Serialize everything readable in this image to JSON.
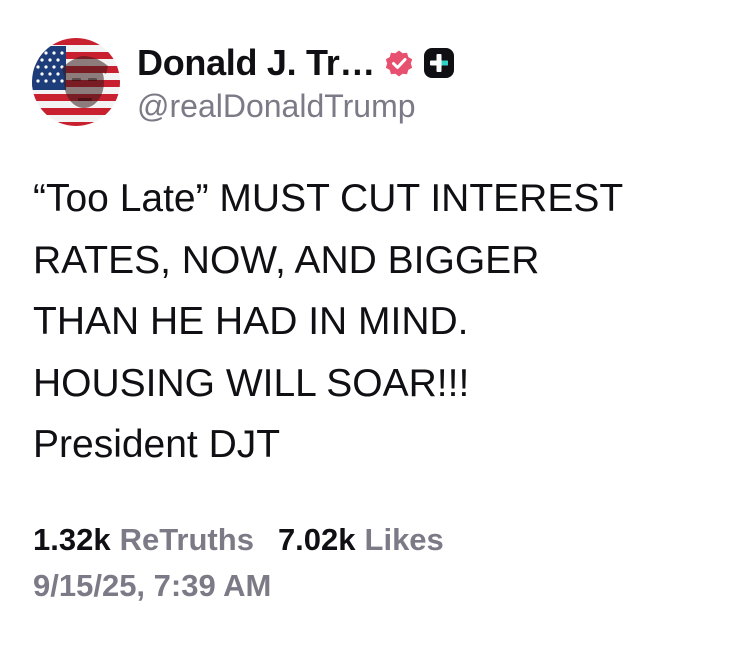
{
  "author": {
    "display_name": "Donald J. Tr…",
    "handle": "@realDonaldTrump",
    "avatar_icon": "avatar-flag-portrait",
    "verified_icon": "verified-badge-icon",
    "verified_color": "#e8506f",
    "extra_badge_icon": "plus-badge-icon",
    "extra_badge_color": "#0f0f14"
  },
  "post": {
    "lines": [
      "“Too Late” MUST CUT INTEREST",
      "RATES, NOW, AND BIGGER",
      "THAN HE HAD IN MIND.",
      "HOUSING WILL SOAR!!!",
      "President DJT"
    ]
  },
  "stats": {
    "retruths_count": "1.32k",
    "retruths_label": "ReTruths",
    "likes_count": "7.02k",
    "likes_label": "Likes"
  },
  "timestamp": "9/15/25, 7:39 AM",
  "colors": {
    "text": "#0f0f14",
    "secondary": "#7b7a86",
    "background": "#ffffff"
  }
}
